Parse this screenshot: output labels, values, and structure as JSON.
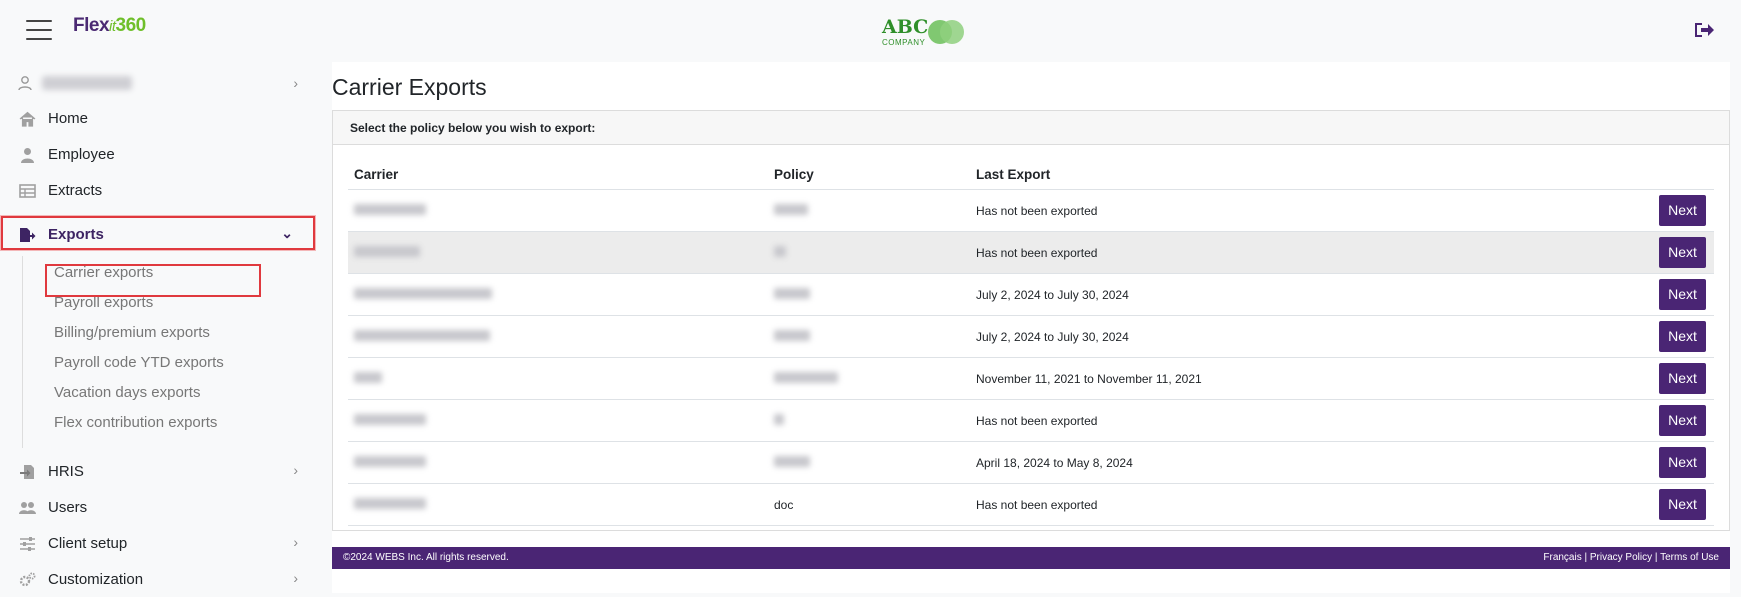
{
  "header": {
    "logo_part1": "Flex",
    "logo_part2": "it",
    "logo_part3": "360",
    "company_logo_text": "ABC",
    "company_logo_sub": "COMPANY"
  },
  "sidebar": {
    "items": [
      {
        "label": "Home",
        "icon": "home-icon"
      },
      {
        "label": "Employee",
        "icon": "person-icon"
      },
      {
        "label": "Extracts",
        "icon": "table-icon"
      },
      {
        "label": "Exports",
        "icon": "file-export-icon"
      },
      {
        "label": "HRIS",
        "icon": "file-import-icon"
      },
      {
        "label": "Users",
        "icon": "users-icon"
      },
      {
        "label": "Client setup",
        "icon": "sliders-icon"
      },
      {
        "label": "Customization",
        "icon": "gears-icon"
      }
    ],
    "exports_submenu": [
      "Carrier exports",
      "Payroll exports",
      "Billing/premium exports",
      "Payroll code YTD exports",
      "Vacation days exports",
      "Flex contribution exports"
    ]
  },
  "main": {
    "title": "Carrier Exports",
    "card_header": "Select the policy below you wish to export:",
    "columns": [
      "Carrier",
      "Policy",
      "Last Export"
    ],
    "button_label": "Next",
    "rows": [
      {
        "policy": "",
        "last_export": "Has not been exported"
      },
      {
        "policy": "",
        "last_export": "Has not been exported"
      },
      {
        "policy": "",
        "last_export": "July 2, 2024 to July 30, 2024"
      },
      {
        "policy": "",
        "last_export": "July 2, 2024 to July 30, 2024"
      },
      {
        "policy": "",
        "last_export": "November 11, 2021 to November 11, 2021"
      },
      {
        "policy": "",
        "last_export": "Has not been exported"
      },
      {
        "policy": "",
        "last_export": "April 18, 2024 to May 8, 2024"
      },
      {
        "policy": "doc",
        "last_export": "Has not been exported"
      }
    ]
  },
  "footer": {
    "copyright": "©2024 WEBS Inc. All rights reserved.",
    "links": "Français  |  Privacy Policy  |  Terms of Use"
  },
  "colors": {
    "brand_purple": "#4a2574",
    "highlight_red": "#e0393e",
    "logo_green": "#6fbf2a"
  }
}
